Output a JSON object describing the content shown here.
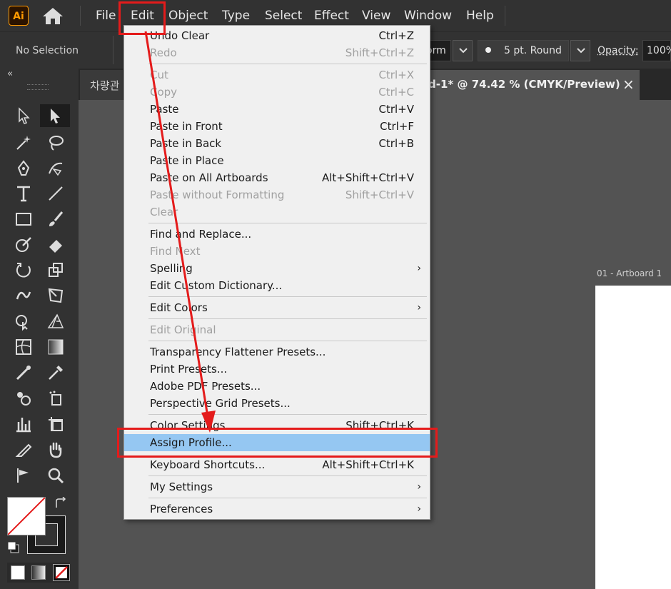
{
  "app": {
    "logo": "Ai"
  },
  "menubar": {
    "items": [
      "File",
      "Edit",
      "Object",
      "Type",
      "Select",
      "Effect",
      "View",
      "Window",
      "Help"
    ]
  },
  "control": {
    "selection": "No Selection",
    "form_tail": "orm",
    "brush": "5 pt. Round",
    "opacity_label": "Opacity:",
    "opacity_value": "100%"
  },
  "tabs": {
    "left_tab": "차량관",
    "doc_title": "d-1* @ 74.42 % (CMYK/Preview)",
    "close": "×"
  },
  "artboard": {
    "label": "01 - Artboard 1"
  },
  "toolbar": {
    "collapse": "«"
  },
  "edit_menu": {
    "items": [
      {
        "label": "Undo Clear",
        "shortcut": "Ctrl+Z",
        "disabled": false
      },
      {
        "label": "Redo",
        "shortcut": "Shift+Ctrl+Z",
        "disabled": true
      },
      {
        "label": "Cut",
        "shortcut": "Ctrl+X",
        "disabled": true
      },
      {
        "label": "Copy",
        "shortcut": "Ctrl+C",
        "disabled": true
      },
      {
        "label": "Paste",
        "shortcut": "Ctrl+V",
        "disabled": false
      },
      {
        "label": "Paste in Front",
        "shortcut": "Ctrl+F",
        "disabled": false
      },
      {
        "label": "Paste in Back",
        "shortcut": "Ctrl+B",
        "disabled": false
      },
      {
        "label": "Paste in Place",
        "shortcut": "",
        "disabled": false
      },
      {
        "label": "Paste on All Artboards",
        "shortcut": "Alt+Shift+Ctrl+V",
        "disabled": false
      },
      {
        "label": "Paste without Formatting",
        "shortcut": "Shift+Ctrl+V",
        "disabled": true
      },
      {
        "label": "Clear",
        "shortcut": "",
        "disabled": true
      },
      {
        "label": "Find and Replace...",
        "shortcut": "",
        "disabled": false
      },
      {
        "label": "Find Next",
        "shortcut": "",
        "disabled": true
      },
      {
        "label": "Spelling",
        "shortcut": "",
        "disabled": false,
        "submenu": true
      },
      {
        "label": "Edit Custom Dictionary...",
        "shortcut": "",
        "disabled": false
      },
      {
        "label": "Edit Colors",
        "shortcut": "",
        "disabled": false,
        "submenu": true
      },
      {
        "label": "Edit Original",
        "shortcut": "",
        "disabled": true
      },
      {
        "label": "Transparency Flattener Presets...",
        "shortcut": "",
        "disabled": false
      },
      {
        "label": "Print Presets...",
        "shortcut": "",
        "disabled": false
      },
      {
        "label": "Adobe PDF Presets...",
        "shortcut": "",
        "disabled": false
      },
      {
        "label": "Perspective Grid Presets...",
        "shortcut": "",
        "disabled": false
      },
      {
        "label": "Color Settings...",
        "shortcut": "Shift+Ctrl+K",
        "disabled": false
      },
      {
        "label": "Assign Profile...",
        "shortcut": "",
        "disabled": false,
        "highlighted": true
      },
      {
        "label": "Keyboard Shortcuts...",
        "shortcut": "Alt+Shift+Ctrl+K",
        "disabled": false
      },
      {
        "label": "My Settings",
        "shortcut": "",
        "disabled": false,
        "submenu": true
      },
      {
        "label": "Preferences",
        "shortcut": "",
        "disabled": false,
        "submenu": true
      }
    ],
    "submenu_arrow": "›"
  },
  "colors": {
    "accent": "#e41b1b",
    "highlight": "#95c7f2",
    "brand": "#ff9a00"
  }
}
